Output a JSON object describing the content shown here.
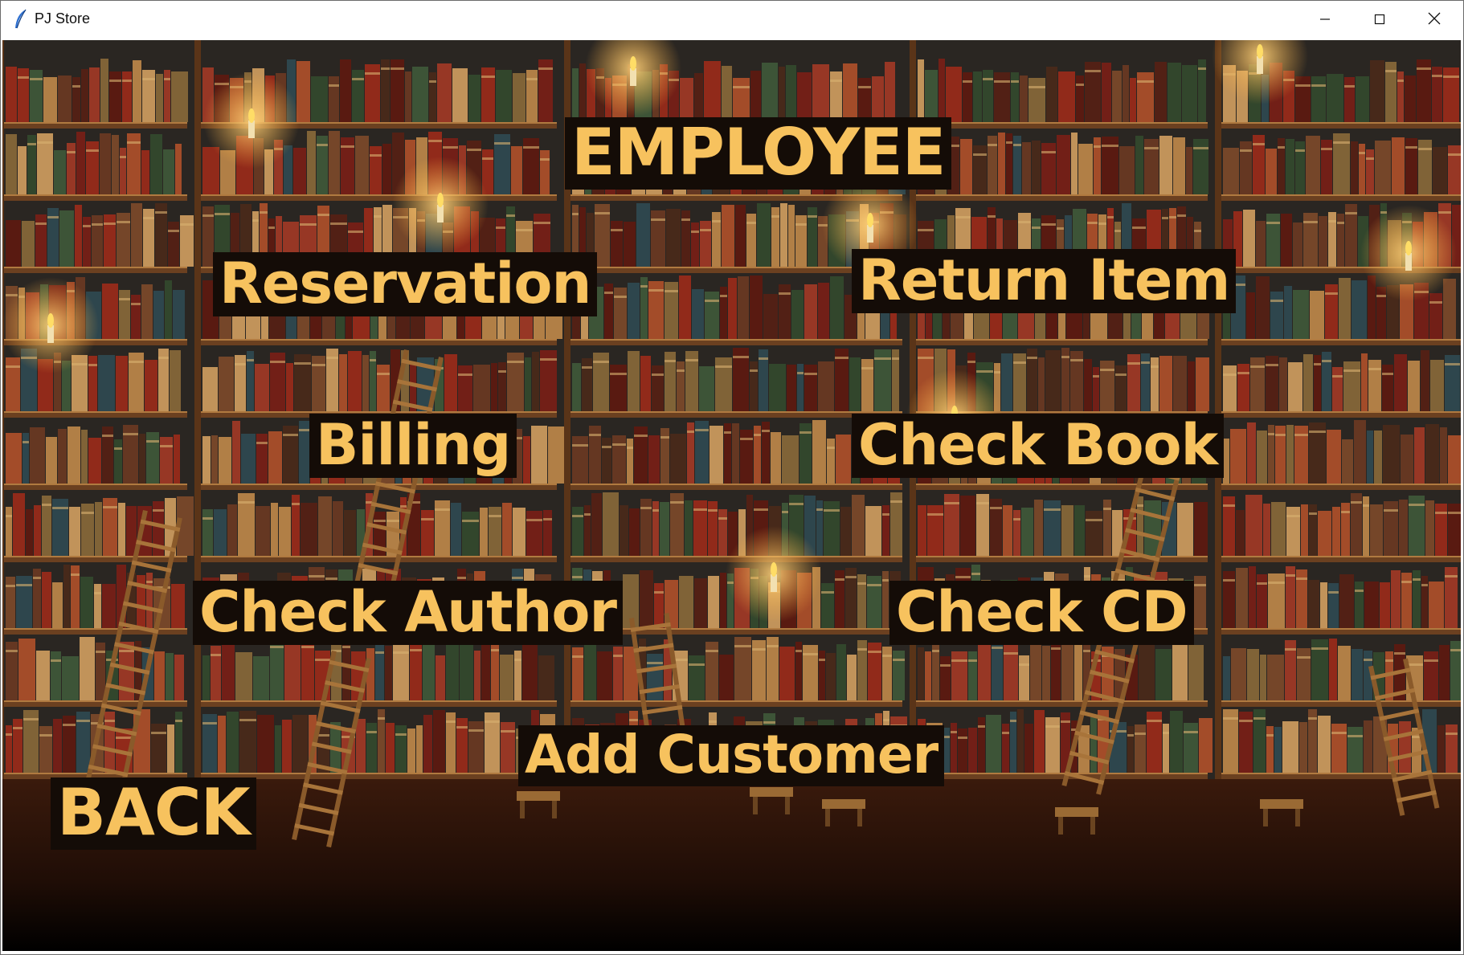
{
  "window": {
    "title": "PJ Store",
    "icon": "feather-icon",
    "controls": {
      "minimize": "minimize-icon",
      "maximize": "maximize-icon",
      "close": "close-icon"
    }
  },
  "main": {
    "heading": "EMPLOYEE",
    "buttons": {
      "reservation": "Reservation",
      "return_item": "Return Item",
      "billing": "Billing",
      "check_book": "Check Book",
      "check_author": "Check Author",
      "check_cd": "Check CD",
      "add_customer": "Add Customer",
      "back": "BACK"
    },
    "colors": {
      "label_text": "#f7c25e",
      "label_bg": "#140c07"
    },
    "background": "library-bookshelves-image"
  }
}
